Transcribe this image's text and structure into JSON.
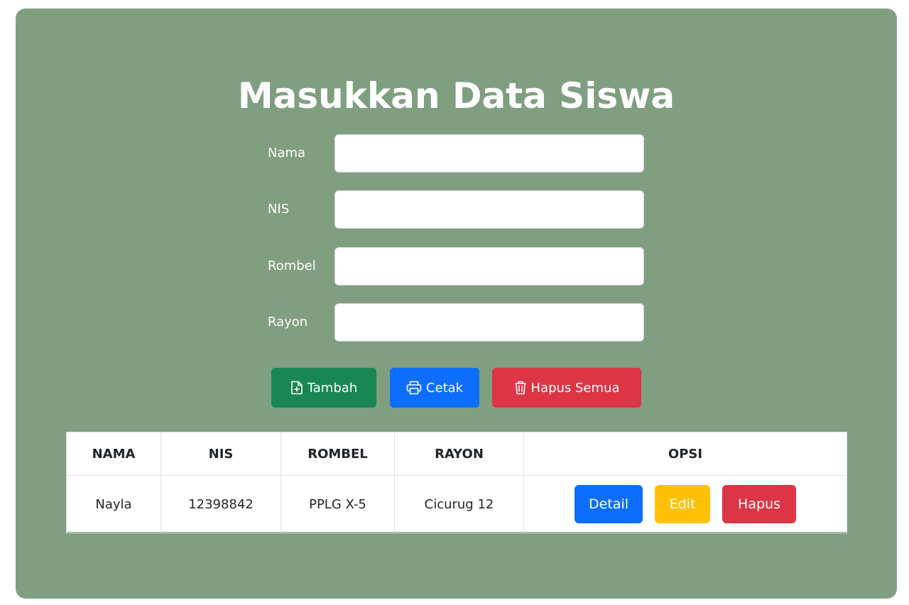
{
  "header": {
    "title": "Masukkan Data Siswa"
  },
  "form": {
    "fields": [
      {
        "label": "Nama",
        "value": "",
        "placeholder": ""
      },
      {
        "label": "NIS",
        "value": "",
        "placeholder": ""
      },
      {
        "label": "Rombel",
        "value": "",
        "placeholder": ""
      },
      {
        "label": "Rayon",
        "value": "",
        "placeholder": ""
      }
    ]
  },
  "actions": {
    "add_label": "Tambah",
    "print_label": "Cetak",
    "delete_all_label": "Hapus Semua"
  },
  "table": {
    "headers": [
      "NAMA",
      "NIS",
      "ROMBEL",
      "RAYON",
      "OPSI"
    ],
    "rows": [
      {
        "nama": "Nayla",
        "nis": "12398842",
        "rombel": "PPLG X-5",
        "rayon": "Cicurug 12",
        "buttons": {
          "detail": "Detail",
          "edit": "Edit",
          "hapus": "Hapus"
        }
      }
    ]
  },
  "colors": {
    "card_background": "#809f81",
    "success": "#198754",
    "primary": "#0d6efd",
    "danger": "#dc3545",
    "warning": "#ffc107"
  },
  "icons": {
    "add": "file-plus-icon",
    "print": "printer-icon",
    "delete_all": "trash-icon"
  }
}
